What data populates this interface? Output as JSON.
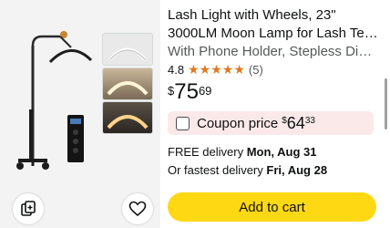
{
  "product": {
    "title_line1": "Lash Light with Wheels, 23\"",
    "title_line2": "3000LM Moon Lamp for Lash Tec...",
    "title_line3": "With Phone Holder, Stepless Dim...",
    "rating": "4.8",
    "stars_filled": 5,
    "review_count": "(5)",
    "price": {
      "symbol": "$",
      "whole": "75",
      "fraction": "69"
    }
  },
  "coupon": {
    "label": "Coupon price",
    "price": {
      "symbol": "$",
      "whole": "64",
      "fraction": "33"
    },
    "background": "#fbe9e9"
  },
  "delivery": {
    "free_prefix": "FREE delivery ",
    "free_date": "Mon, Aug 31",
    "fast_prefix": "Or fastest delivery ",
    "fast_date": "Fri, Aug 28"
  },
  "actions": {
    "add_to_cart_label": "Add to cart",
    "add_to_cart_color": "#ffd814",
    "compare_icon": "compare-icon",
    "wishlist_icon": "heart-icon"
  },
  "colors": {
    "star": "#de7921",
    "secondary_text": "#565959"
  }
}
